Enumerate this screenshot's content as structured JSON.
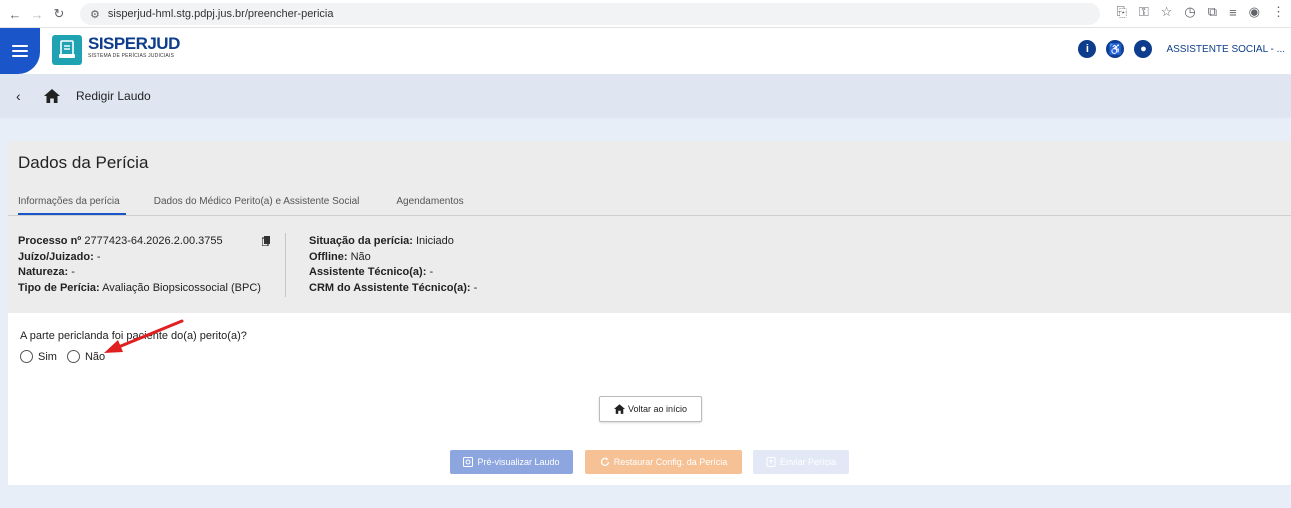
{
  "browser": {
    "url": "sisperjud-hml.stg.pdpj.jus.br/preencher-pericia"
  },
  "header": {
    "logo_title": "SISPERJUD",
    "logo_subtitle": "SISTEMA DE PERÍCIAS JUDICIAIS",
    "user_label": "ASSISTENTE SOCIAL - ..."
  },
  "breadcrumb": {
    "current": "Redigir Laudo"
  },
  "panel": {
    "title": "Dados da Perícia",
    "tabs": [
      {
        "label": "Informações da perícia"
      },
      {
        "label": "Dados do Médico Perito(a) e Assistente Social"
      },
      {
        "label": "Agendamentos"
      }
    ],
    "left": {
      "processo_label": "Processo nº",
      "processo_value": "2777423-64.2026.2.00.3755",
      "juizo_label": "Juízo/Juizado:",
      "juizo_value": "-",
      "natureza_label": "Natureza:",
      "natureza_value": "-",
      "tipo_label": "Tipo de Perícia:",
      "tipo_value": "Avaliação Biopsicossocial (BPC)"
    },
    "right": {
      "situacao_label": "Situação da perícia:",
      "situacao_value": "Iniciado",
      "offline_label": "Offline:",
      "offline_value": "Não",
      "assistente_label": "Assistente Técnico(a):",
      "assistente_value": "-",
      "crm_label": "CRM do Assistente Técnico(a):",
      "crm_value": "-"
    }
  },
  "question": {
    "text": "A parte periclanda foi paciente do(a) perito(a)?",
    "options": [
      {
        "label": "Sim",
        "selected": false
      },
      {
        "label": "Não",
        "selected": false
      }
    ]
  },
  "buttons": {
    "home": "Voltar ao início",
    "preview": "Pré-visualizar Laudo",
    "restore": "Restaurar Config. da Perícia",
    "send": "Enviar Perícia"
  },
  "colors": {
    "primary": "#1a56c9",
    "annotation_arrow": "#e02020"
  }
}
